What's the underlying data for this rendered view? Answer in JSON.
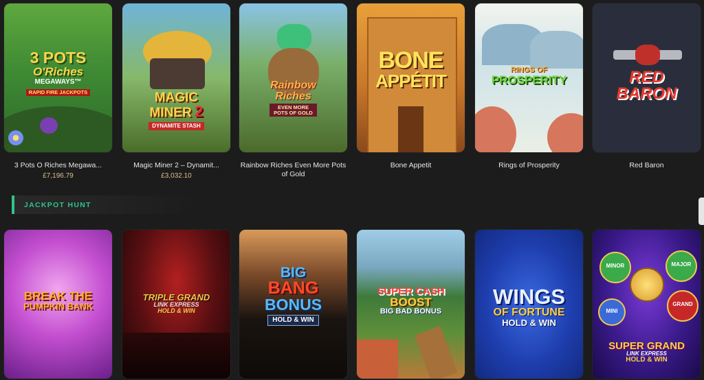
{
  "row1": [
    {
      "id": "3pots",
      "logo_line1": "3 POTS",
      "logo_line2": "O'Riches",
      "logo_line3": "MEGAWAYS™",
      "logo_line4": "RAPID FIRE JACKPOTS",
      "name": "3 Pots O Riches Megawa...",
      "prize": "£7,196.79"
    },
    {
      "id": "magicminer",
      "logo_line1": "MAGIC",
      "logo_line2": "MINER",
      "logo_line3": "2",
      "logo_line4": "DYNAMITE STASH",
      "name": "Magic Miner 2 – Dynamit...",
      "prize": "£3,032.10"
    },
    {
      "id": "rainbow",
      "logo_line1": "Rainbow",
      "logo_line2": "Riches",
      "logo_line3": "EVEN MORE",
      "logo_line4": "POTS OF GOLD",
      "name": "Rainbow Riches Even More Pots of Gold"
    },
    {
      "id": "bone",
      "logo_line1": "BONE",
      "logo_line2": "APPÉTIT",
      "name": "Bone Appetit"
    },
    {
      "id": "rings",
      "logo_line1": "RINGS OF",
      "logo_line2": "PROSPERITY",
      "name": "Rings of Prosperity"
    },
    {
      "id": "redbaron",
      "logo_line1": "RED",
      "logo_line2": "BARON",
      "name": "Red Baron"
    }
  ],
  "section": {
    "title": "JACKPOT HUNT"
  },
  "row2": [
    {
      "id": "pumpkin",
      "logo_line1": "BREAK the",
      "logo_line2": "PUMPKIN BANK"
    },
    {
      "id": "triple",
      "logo_line1": "TRIPLE GRAND",
      "logo_line2": "LINK EXPRESS",
      "logo_line3": "HOLD & WIN"
    },
    {
      "id": "bigbang",
      "logo_line1": "BIG",
      "logo_line2": "BANG",
      "logo_line3": "BONUS",
      "logo_line4": "HOLD & WIN"
    },
    {
      "id": "supercash",
      "logo_line1": "SUPER CASH",
      "logo_line2": "BOOST",
      "logo_line3": "BIG BAD BONUS"
    },
    {
      "id": "wings",
      "logo_line1": "WINGS",
      "logo_line2": "of FORTUNE",
      "logo_line3": "HOLD & WIN"
    },
    {
      "id": "supergrand",
      "logo_line1": "SUPER GRAND",
      "logo_line2": "LINK EXPRESS",
      "logo_line3": "HOLD & WIN",
      "badge_minor": "MINOR",
      "badge_major": "MAJOR",
      "badge_mini": "MINI",
      "badge_grand": "GRAND"
    }
  ],
  "colors": {
    "accent": "#2fc48a",
    "background": "#1c1c1c",
    "prize": "#d8c08a"
  }
}
